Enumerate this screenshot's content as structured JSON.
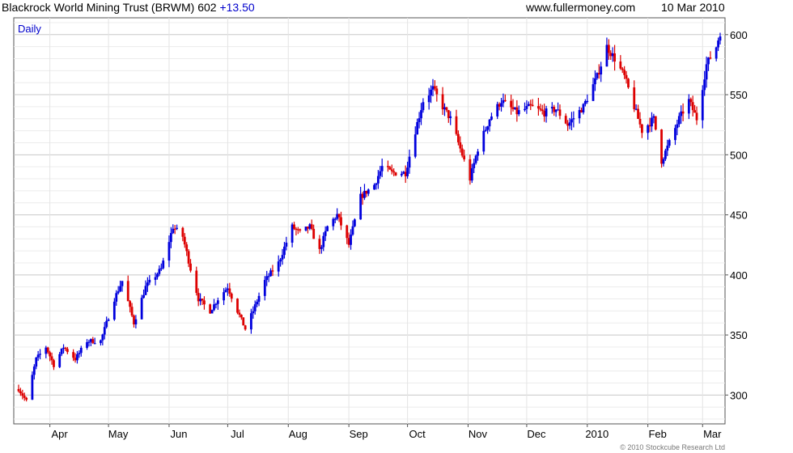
{
  "header": {
    "title": "Blackrock World Mining Trust (BRWM) 602",
    "change": "+13.50",
    "site": "www.fullermoney.com",
    "date": "10 Mar 2010"
  },
  "footer": {
    "copyright": "© 2010 Stockcube Research Ltd"
  },
  "colors": {
    "up": "#0000dd",
    "down": "#dd0000",
    "grid": "#d8d8d8",
    "frame": "#555555"
  },
  "chart_data": {
    "type": "ohlc",
    "period_label": "Daily",
    "x_start": "2009-03-16",
    "x_end": "2010-03-10",
    "ylim": [
      276,
      614
    ],
    "y_ticks": [
      300,
      350,
      400,
      450,
      500,
      550,
      600
    ],
    "x_ticks": [
      {
        "label": "Apr",
        "date": "2009-04-01"
      },
      {
        "label": "May",
        "date": "2009-05-01"
      },
      {
        "label": "Jun",
        "date": "2009-06-01"
      },
      {
        "label": "Jul",
        "date": "2009-07-01"
      },
      {
        "label": "Aug",
        "date": "2009-08-01"
      },
      {
        "label": "Sep",
        "date": "2009-09-01"
      },
      {
        "label": "Oct",
        "date": "2009-10-01"
      },
      {
        "label": "Nov",
        "date": "2009-11-01"
      },
      {
        "label": "Dec",
        "date": "2009-12-01"
      },
      {
        "label": "2010",
        "date": "2010-01-01"
      },
      {
        "label": "Feb",
        "date": "2010-02-01"
      },
      {
        "label": "Mar",
        "date": "2010-03-01"
      }
    ],
    "anchors": [
      [
        "2009-03-16",
        305
      ],
      [
        "2009-03-20",
        295
      ],
      [
        "2009-03-25",
        330
      ],
      [
        "2009-03-30",
        340
      ],
      [
        "2009-04-03",
        325
      ],
      [
        "2009-04-08",
        340
      ],
      [
        "2009-04-14",
        330
      ],
      [
        "2009-04-20",
        345
      ],
      [
        "2009-04-27",
        345
      ],
      [
        "2009-05-04",
        380
      ],
      [
        "2009-05-08",
        395
      ],
      [
        "2009-05-14",
        360
      ],
      [
        "2009-05-20",
        390
      ],
      [
        "2009-05-28",
        405
      ],
      [
        "2009-06-03",
        440
      ],
      [
        "2009-06-08",
        432
      ],
      [
        "2009-06-12",
        405
      ],
      [
        "2009-06-16",
        380
      ],
      [
        "2009-06-22",
        370
      ],
      [
        "2009-06-26",
        380
      ],
      [
        "2009-07-01",
        390
      ],
      [
        "2009-07-06",
        370
      ],
      [
        "2009-07-10",
        355
      ],
      [
        "2009-07-14",
        370
      ],
      [
        "2009-07-20",
        395
      ],
      [
        "2009-07-27",
        410
      ],
      [
        "2009-08-03",
        440
      ],
      [
        "2009-08-07",
        435
      ],
      [
        "2009-08-12",
        440
      ],
      [
        "2009-08-17",
        420
      ],
      [
        "2009-08-21",
        440
      ],
      [
        "2009-08-26",
        450
      ],
      [
        "2009-09-01",
        425
      ],
      [
        "2009-09-07",
        465
      ],
      [
        "2009-09-14",
        475
      ],
      [
        "2009-09-18",
        490
      ],
      [
        "2009-09-23",
        485
      ],
      [
        "2009-09-30",
        485
      ],
      [
        "2009-10-05",
        520
      ],
      [
        "2009-10-09",
        545
      ],
      [
        "2009-10-14",
        555
      ],
      [
        "2009-10-19",
        540
      ],
      [
        "2009-10-23",
        530
      ],
      [
        "2009-10-27",
        510
      ],
      [
        "2009-11-02",
        480
      ],
      [
        "2009-11-06",
        505
      ],
      [
        "2009-11-12",
        530
      ],
      [
        "2009-11-18",
        545
      ],
      [
        "2009-11-26",
        535
      ],
      [
        "2009-12-03",
        540
      ],
      [
        "2009-12-10",
        535
      ],
      [
        "2009-12-16",
        538
      ],
      [
        "2009-12-22",
        525
      ],
      [
        "2009-12-30",
        540
      ],
      [
        "2010-01-06",
        565
      ],
      [
        "2010-01-11",
        590
      ],
      [
        "2010-01-15",
        580
      ],
      [
        "2010-01-20",
        565
      ],
      [
        "2010-01-25",
        540
      ],
      [
        "2010-01-29",
        520
      ],
      [
        "2010-02-04",
        530
      ],
      [
        "2010-02-08",
        495
      ],
      [
        "2010-02-12",
        510
      ],
      [
        "2010-02-17",
        530
      ],
      [
        "2010-02-22",
        545
      ],
      [
        "2010-02-26",
        530
      ],
      [
        "2010-03-03",
        575
      ],
      [
        "2010-03-08",
        590
      ],
      [
        "2010-03-10",
        602
      ]
    ]
  }
}
